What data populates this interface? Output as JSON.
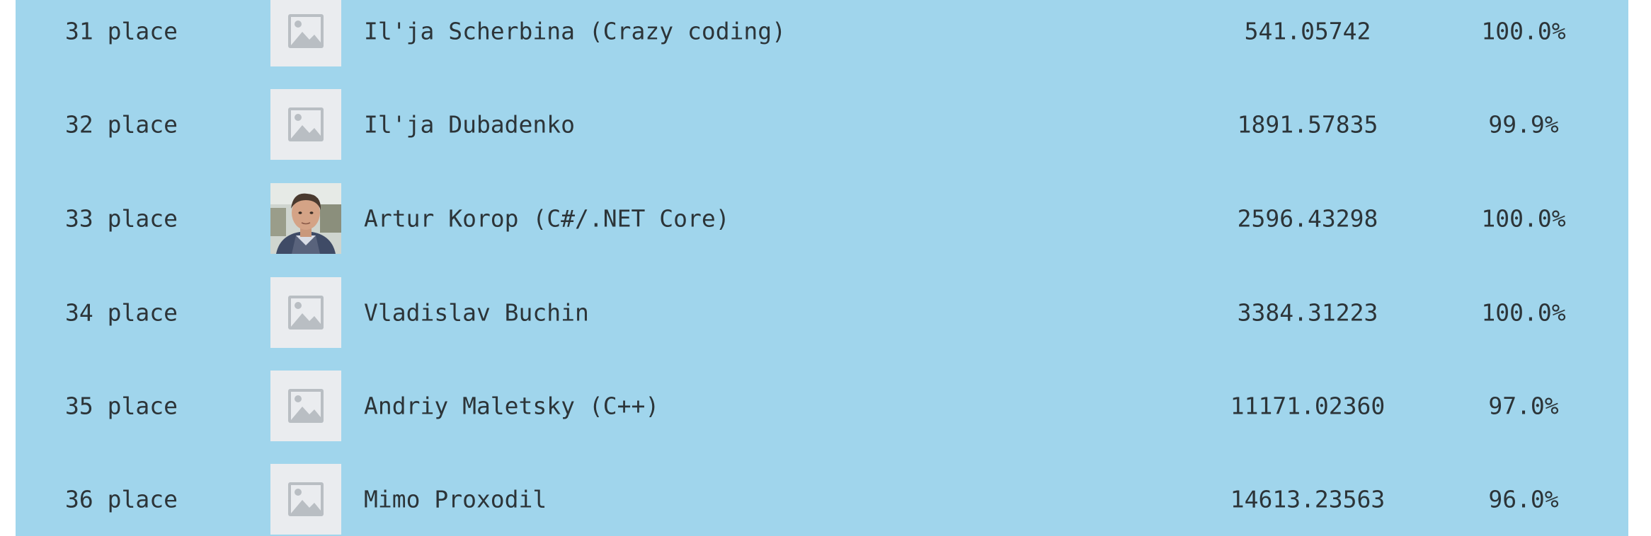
{
  "leaderboard": {
    "rows": [
      {
        "place": "31 place",
        "name": "Il'ja Scherbina (Crazy coding)",
        "score": "541.05742",
        "percent": "100.0%",
        "avatar": "placeholder-image-icon"
      },
      {
        "place": "32 place",
        "name": "Il'ja Dubadenko",
        "score": "1891.57835",
        "percent": "99.9%",
        "avatar": "placeholder-image-icon"
      },
      {
        "place": "33 place",
        "name": "Artur Korop (C#/.NET Core)",
        "score": "2596.43298",
        "percent": "100.0%",
        "avatar": "user-photo"
      },
      {
        "place": "34 place",
        "name": "Vladislav Buchin",
        "score": "3384.31223",
        "percent": "100.0%",
        "avatar": "placeholder-image-icon"
      },
      {
        "place": "35 place",
        "name": "Andriy Maletsky (C++)",
        "score": "11171.02360",
        "percent": "97.0%",
        "avatar": "placeholder-image-icon"
      },
      {
        "place": "36 place",
        "name": "Mimo Proxodil",
        "score": "14613.23563",
        "percent": "96.0%",
        "avatar": "placeholder-image-icon"
      }
    ]
  },
  "colors": {
    "panel_background": "#a0d5ec",
    "text": "#2c3438",
    "placeholder_background": "#eaecef",
    "placeholder_icon": "#b9bec3"
  }
}
